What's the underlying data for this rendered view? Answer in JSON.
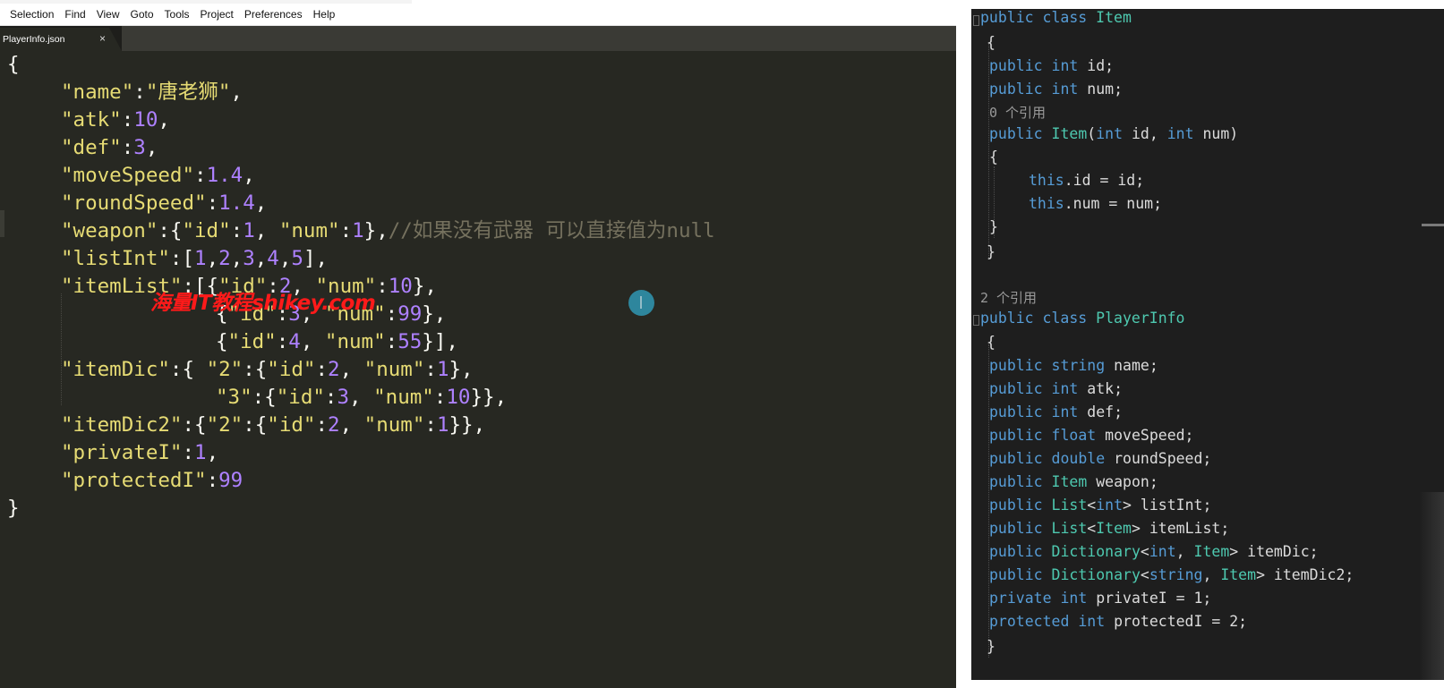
{
  "menu": [
    "Selection",
    "Find",
    "View",
    "Goto",
    "Tools",
    "Project",
    "Preferences",
    "Help"
  ],
  "tab": {
    "title": "PlayerInfo.json",
    "close": "×"
  },
  "json_code": {
    "l1": "{",
    "l2_key": "\"name\"",
    "l2_val": "\"唐老狮\"",
    "l3_key": "\"atk\"",
    "l3_val": "10",
    "l4_key": "\"def\"",
    "l4_val": "3",
    "l5_key": "\"moveSpeed\"",
    "l5_val": "1.4",
    "l6_key": "\"roundSpeed\"",
    "l6_val": "1.4",
    "l7_key": "\"weapon\"",
    "l7_k1": "\"id\"",
    "l7_v1": "1",
    "l7_k2": "\"num\"",
    "l7_v2": "1",
    "l7_comment": "//如果没有武器 可以直接值为null",
    "l8_key": "\"listInt\"",
    "l8_v1": "1",
    "l8_v2": "2",
    "l8_v3": "3",
    "l8_v4": "4",
    "l8_v5": "5",
    "l9_key": "\"itemList\"",
    "l9_k1": "\"id\"",
    "l9_v1": "2",
    "l9_k2": "\"num\"",
    "l9_v2": "10",
    "l10_k1": "\"id\"",
    "l10_v1": "3",
    "l10_k2": "\"num\"",
    "l10_v2": "99",
    "l11_k1": "\"id\"",
    "l11_v1": "4",
    "l11_k2": "\"num\"",
    "l11_v2": "55",
    "l12_key": "\"itemDic\"",
    "l12_k0": "\"2\"",
    "l12_k1": "\"id\"",
    "l12_v1": "2",
    "l12_k2": "\"num\"",
    "l12_v2": "1",
    "l13_k0": "\"3\"",
    "l13_k1": "\"id\"",
    "l13_v1": "3",
    "l13_k2": "\"num\"",
    "l13_v2": "10",
    "l14_key": "\"itemDic2\"",
    "l14_k0": "\"2\"",
    "l14_k1": "\"id\"",
    "l14_v1": "2",
    "l14_k2": "\"num\"",
    "l14_v2": "1",
    "l15_key": "\"privateI\"",
    "l15_val": "1",
    "l16_key": "\"protectedI\"",
    "l16_val": "99",
    "l17": "}"
  },
  "watermark": "海量IT教程shikey.com",
  "csharp": {
    "kw_public": "public",
    "kw_class": "class",
    "kw_int": "int",
    "kw_this": "this",
    "kw_string": "string",
    "kw_float": "float",
    "kw_double": "double",
    "kw_private": "private",
    "kw_protected": "protected",
    "ty_List": "List",
    "ty_Dictionary": "Dictionary",
    "ty_Item": "Item",
    "item_class": "Item",
    "f_id": "id;",
    "f_num": "num;",
    "ref0": "0 个引用",
    "ctor_name": "Item",
    "ctor_params_a": "(",
    "ctor_p1": " id, ",
    "ctor_p2": " num)",
    "assign1": ".id = id;",
    "assign2": ".num = num;",
    "ref2": "2 个引用",
    "player_class": "PlayerInfo",
    "p_name": " name;",
    "p_atk": " atk;",
    "p_def": " def;",
    "p_move": " moveSpeed;",
    "p_round": " roundSpeed;",
    "p_weapon": " weapon;",
    "p_listInt": "> listInt;",
    "p_itemList": "> itemList;",
    "p_itemDic": "> itemDic;",
    "p_itemDic2": "> itemDic2;",
    "p_private": " privateI = 1;",
    "p_protected": " protectedI = 2;",
    "brace_open": "{",
    "brace_close": "}",
    "lt": "<",
    "comma": ", "
  }
}
